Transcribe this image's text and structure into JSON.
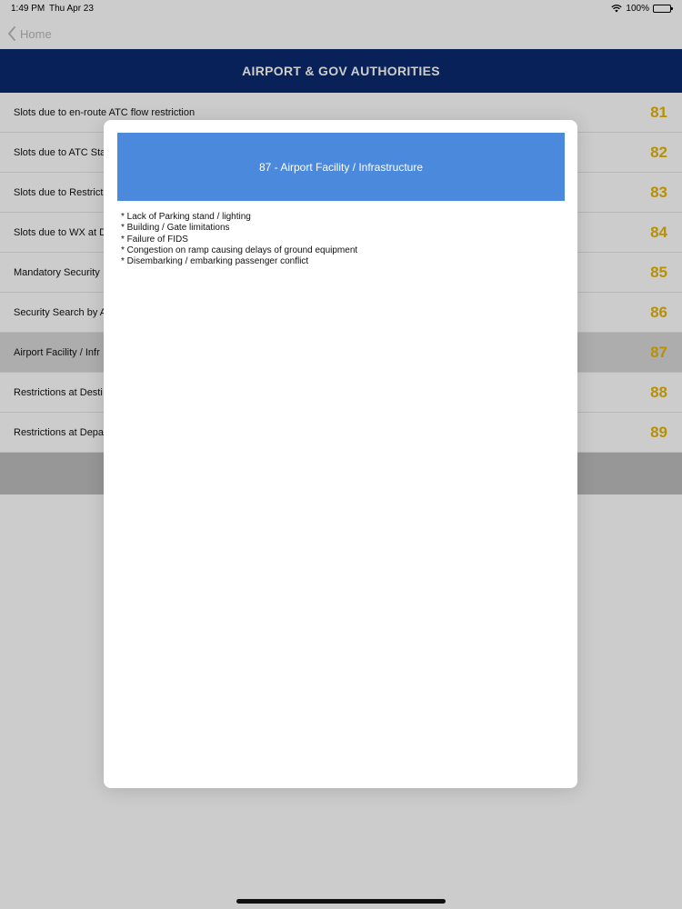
{
  "status_bar": {
    "time": "1:49 PM",
    "date": "Thu Apr 23",
    "battery": "100%"
  },
  "nav": {
    "back_label": "Home"
  },
  "header": {
    "title": "AIRPORT & GOV AUTHORITIES"
  },
  "list": {
    "rows": [
      {
        "label": "Slots due to en-route ATC flow restriction",
        "code": "81"
      },
      {
        "label": "Slots due to ATC Sta",
        "code": "82"
      },
      {
        "label": "Slots due to Restrict",
        "code": "83"
      },
      {
        "label": "Slots due to WX at D",
        "code": "84"
      },
      {
        "label": "Mandatory Security",
        "code": "85"
      },
      {
        "label": "Security Search by A",
        "code": "86"
      },
      {
        "label": "Airport Facility / Infr",
        "code": "87"
      },
      {
        "label": "Restrictions at Desti",
        "code": "88"
      },
      {
        "label": "Restrictions at Depa",
        "code": "89"
      }
    ],
    "selected_index": 6
  },
  "modal": {
    "title": "87 - Airport Facility / Infrastructure",
    "lines": [
      "* Lack of Parking stand / lighting",
      "* Building / Gate limitations",
      "* Failure of FIDS",
      "* Congestion on ramp causing delays of ground equipment",
      "* Disembarking / embarking passenger conflict"
    ]
  },
  "colors": {
    "header_bg": "#0a2a6e",
    "modal_header_bg": "#4a89dc",
    "code_color": "#e8b400"
  }
}
